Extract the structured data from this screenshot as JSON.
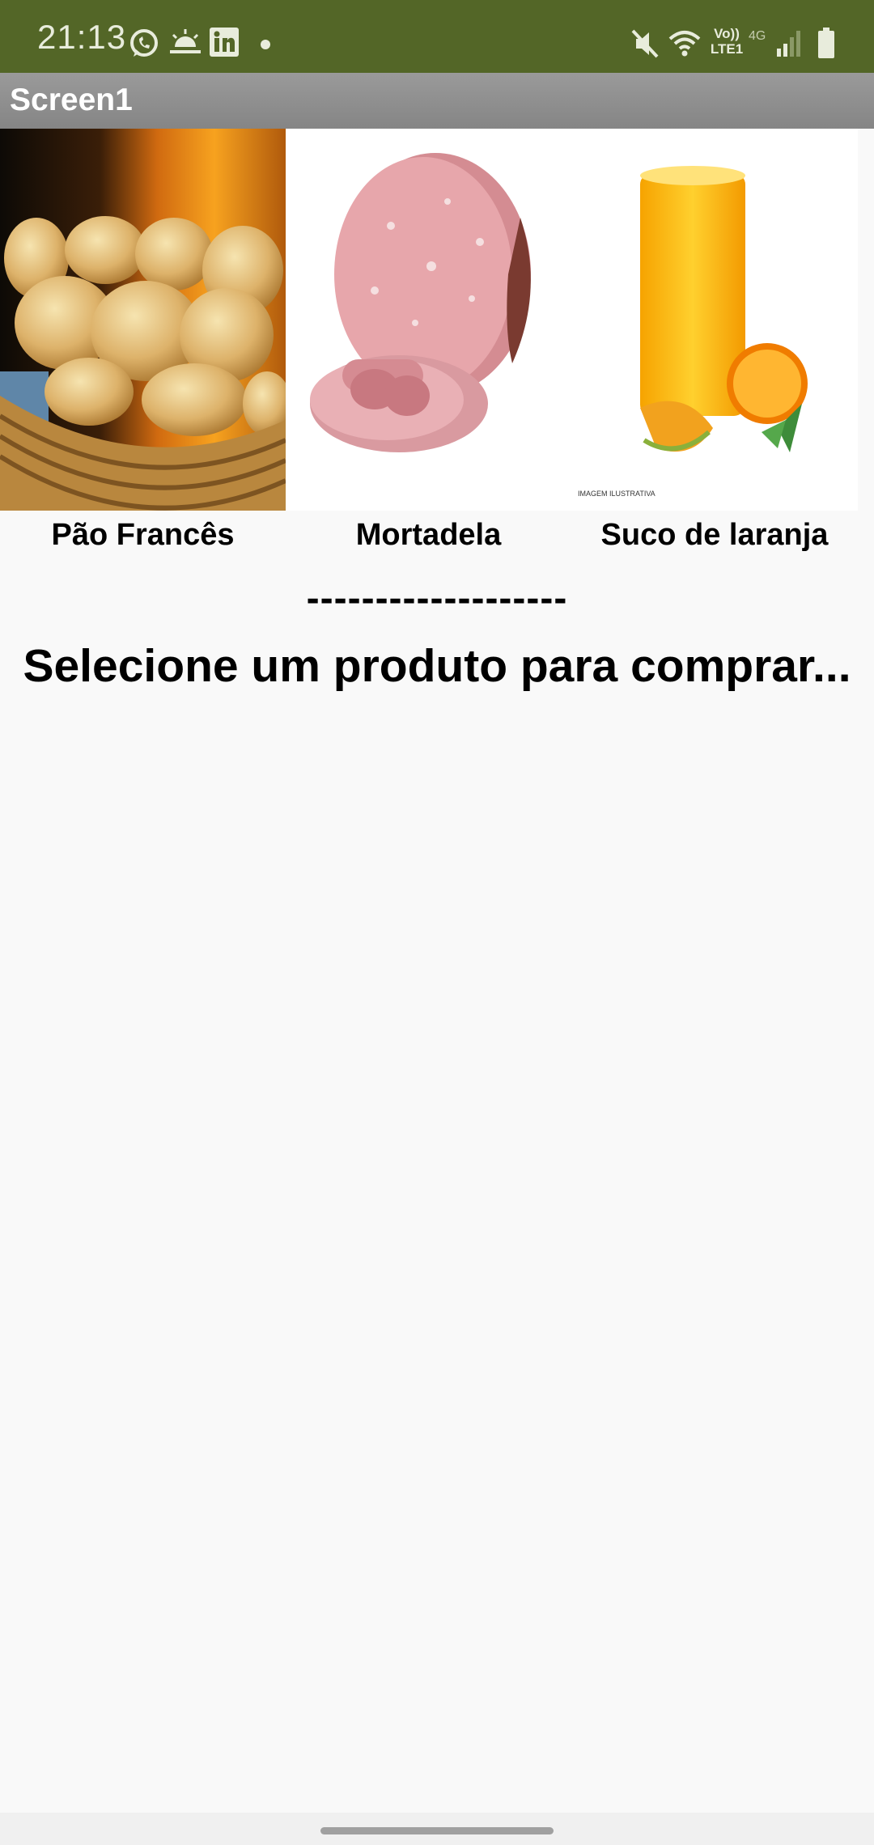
{
  "status_bar": {
    "time": "21:13",
    "left_icons": [
      "whatsapp-icon",
      "weather-icon",
      "linkedin-icon",
      "notification-dot"
    ],
    "right_icons": [
      "mute-icon",
      "wifi-icon",
      "volte-icon",
      "signal-icon",
      "battery-icon"
    ],
    "volte_label": "Vo))",
    "lte_label": "LTE1",
    "network_label": "4G",
    "color": "#536627"
  },
  "app_bar": {
    "title": "Screen1"
  },
  "products": [
    {
      "name": "Pão Francês",
      "image": "bread-basket-image"
    },
    {
      "name": "Mortadela",
      "image": "mortadella-image"
    },
    {
      "name": "Suco de laranja",
      "image": "orange-juice-image",
      "caption": "IMAGEM ILUSTRATIVA"
    }
  ],
  "divider": "-------------------",
  "prompt": "Selecione um produto para comprar..."
}
